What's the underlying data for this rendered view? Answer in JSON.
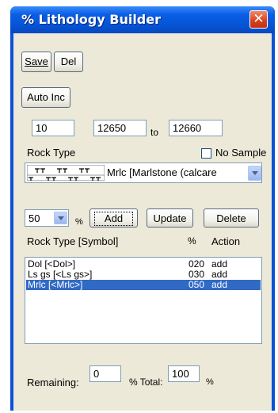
{
  "window": {
    "title": "% Lithology Builder",
    "close_glyph": "✕"
  },
  "toolbar": {
    "save_label": "Save",
    "del_label": "Del",
    "auto_inc_label": "Auto Inc"
  },
  "depth": {
    "value": "10",
    "from": "12650",
    "to_label": "to",
    "to": "12660"
  },
  "rock": {
    "label": "Rock Type",
    "no_sample_label": "No Sample",
    "no_sample_checked": false,
    "selected": "Mrlc [Marlstone (calcare",
    "pattern_icon": "marlstone-pattern-icon"
  },
  "percent": {
    "value": "50",
    "unit": "%"
  },
  "actions": {
    "add_label": "Add",
    "update_label": "Update",
    "delete_label": "Delete"
  },
  "table": {
    "headers": {
      "rock": "Rock Type [Symbol]",
      "pct": "%",
      "action": "Action"
    },
    "rows": [
      {
        "rock": "Dol [<Dol>]",
        "pct": "020",
        "action": "add",
        "selected": false
      },
      {
        "rock": "Ls gs [<Ls gs>]",
        "pct": "030",
        "action": "add",
        "selected": false
      },
      {
        "rock": "Mrlc [<Mrlc>]",
        "pct": "050",
        "action": "add",
        "selected": true
      }
    ]
  },
  "footer": {
    "remaining_label": "Remaining:",
    "remaining_value": "0",
    "total_label": "% Total:",
    "total_value": "100",
    "pct_unit": "%"
  },
  "colors": {
    "titlebar": "#0554d4",
    "client_bg": "#ece9d8",
    "selection": "#316ac5",
    "close_button": "#d8401a"
  }
}
